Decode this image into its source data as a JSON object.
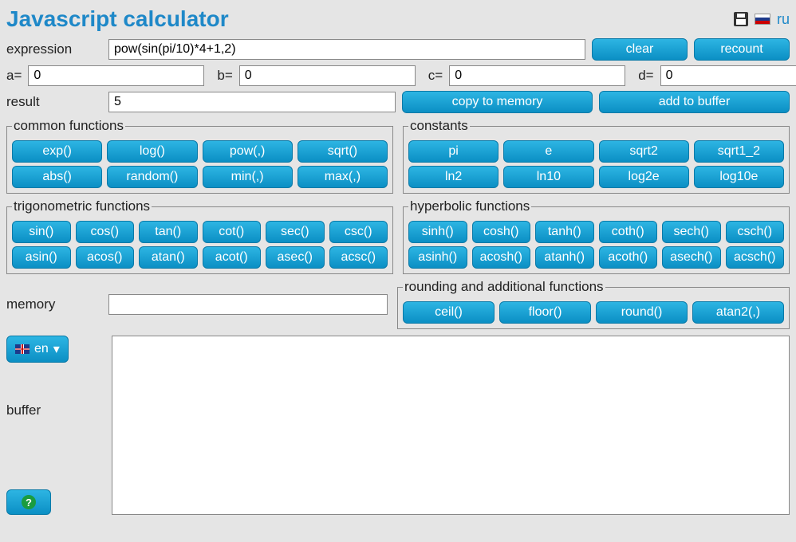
{
  "title": "Javascript calculator",
  "header": {
    "ru_link": "ru"
  },
  "expression": {
    "label": "expression",
    "value": "pow(sin(pi/10)*4+1,2)"
  },
  "actions": {
    "clear": "clear",
    "recount": "recount"
  },
  "vars": {
    "a_label": "a=",
    "a_value": "0",
    "b_label": "b=",
    "b_value": "0",
    "c_label": "c=",
    "c_value": "0",
    "d_label": "d=",
    "d_value": "0"
  },
  "result": {
    "label": "result",
    "value": "5",
    "copy": "copy to memory",
    "add": "add to buffer"
  },
  "groups": {
    "common": {
      "legend": "common functions",
      "row1": [
        "exp()",
        "log()",
        "pow(,)",
        "sqrt()"
      ],
      "row2": [
        "abs()",
        "random()",
        "min(,)",
        "max(,)"
      ]
    },
    "constants": {
      "legend": "constants",
      "row1": [
        "pi",
        "e",
        "sqrt2",
        "sqrt1_2"
      ],
      "row2": [
        "ln2",
        "ln10",
        "log2e",
        "log10e"
      ]
    },
    "trig": {
      "legend": "trigonometric functions",
      "row1": [
        "sin()",
        "cos()",
        "tan()",
        "cot()",
        "sec()",
        "csc()"
      ],
      "row2": [
        "asin()",
        "acos()",
        "atan()",
        "acot()",
        "asec()",
        "acsc()"
      ]
    },
    "hyper": {
      "legend": "hyperbolic functions",
      "row1": [
        "sinh()",
        "cosh()",
        "tanh()",
        "coth()",
        "sech()",
        "csch()"
      ],
      "row2": [
        "asinh()",
        "acosh()",
        "atanh()",
        "acoth()",
        "asech()",
        "acsch()"
      ]
    },
    "rounding": {
      "legend": "rounding and additional functions",
      "row1": [
        "ceil()",
        "floor()",
        "round()",
        "atan2(,)"
      ]
    }
  },
  "memory": {
    "label": "memory",
    "value": ""
  },
  "lang": {
    "selected": "en",
    "arrow": "▾"
  },
  "buffer": {
    "label": "buffer",
    "value": ""
  },
  "help": "?"
}
